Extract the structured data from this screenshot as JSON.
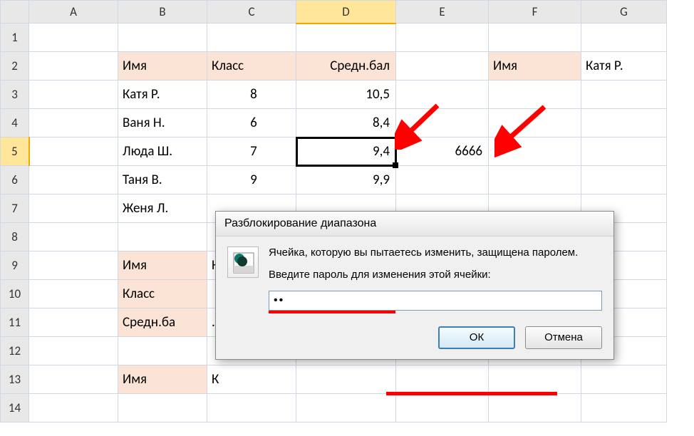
{
  "columns": [
    "A",
    "B",
    "C",
    "D",
    "E",
    "F",
    "G"
  ],
  "rows": [
    "1",
    "2",
    "3",
    "4",
    "5",
    "6",
    "7",
    "8",
    "9",
    "10",
    "11",
    "12",
    "13",
    "14"
  ],
  "selected": {
    "col": "D",
    "row": "5"
  },
  "cells": {
    "B2": "Имя",
    "C2": "Класс",
    "D2": "Средн.бал",
    "F2": "Имя",
    "G2": "Катя Р.",
    "B3": "Катя Р.",
    "C3": "8",
    "D3": "10,5",
    "B4": "Ваня Н.",
    "C4": "6",
    "D4": "8,4",
    "B5": "Люда Ш.",
    "C5": "7",
    "D5": "9,4",
    "E5": "6666",
    "B6": "Таня В.",
    "C6": "9",
    "D6": "9,9",
    "B7": "Женя Л.",
    "B9": "Имя",
    "C9": "К",
    "B10": "Класс",
    "B11": "Средн.ба",
    "C11": ".",
    "B13": "Имя",
    "C13": "К"
  },
  "dialog": {
    "title": "Разблокирование диапазона",
    "line1": "Ячейка, которую вы пытаетесь изменить, защищена паролем.",
    "line2": "Введите пароль для изменения этой ячейки:",
    "password_display": "••",
    "ok": "ОК",
    "cancel": "Отмена"
  }
}
